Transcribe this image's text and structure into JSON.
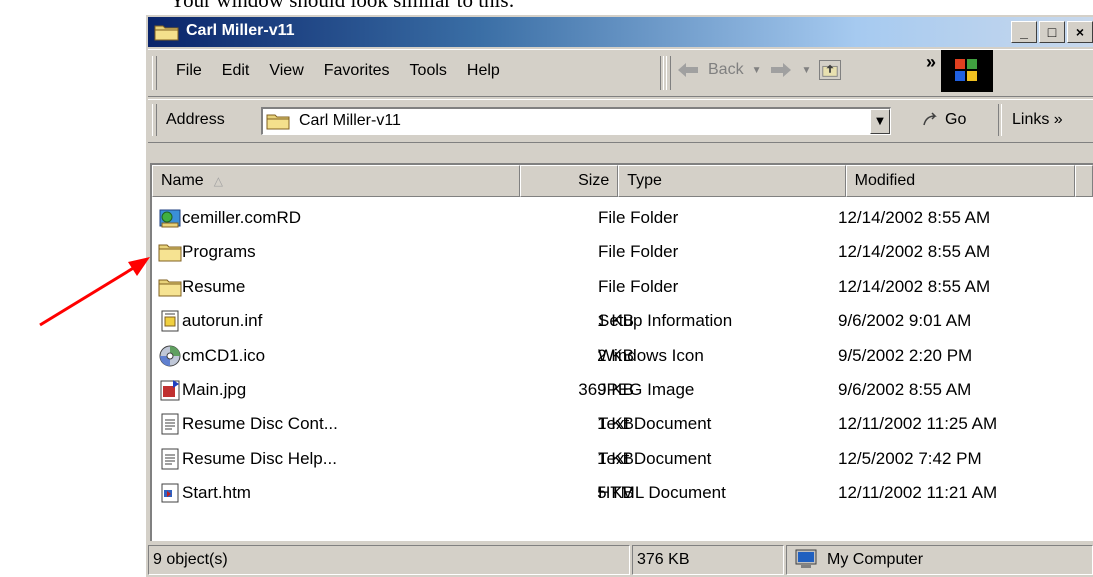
{
  "caption": "Your window should look similar to this:",
  "window": {
    "title": "Carl Miller-v11",
    "buttons": {
      "minimize": "_",
      "maximize": "□",
      "close": "×"
    }
  },
  "menu": {
    "items": [
      "File",
      "Edit",
      "View",
      "Favorites",
      "Tools",
      "Help"
    ],
    "back_label": "Back",
    "chevron": "»"
  },
  "address": {
    "label": "Address",
    "value": "Carl Miller-v11",
    "go_label": "Go",
    "links_label": "Links »"
  },
  "columns": {
    "name": "Name",
    "size": "Size",
    "type": "Type",
    "modified": "Modified"
  },
  "files": [
    {
      "icon": "network-folder-icon",
      "name": "cemiller.comRD",
      "size": "",
      "type": "File Folder",
      "modified": "12/14/2002 8:55 AM"
    },
    {
      "icon": "folder-icon",
      "name": "Programs",
      "size": "",
      "type": "File Folder",
      "modified": "12/14/2002 8:55 AM"
    },
    {
      "icon": "folder-icon",
      "name": "Resume",
      "size": "",
      "type": "File Folder",
      "modified": "12/14/2002 8:55 AM"
    },
    {
      "icon": "setup-info-icon",
      "name": "autorun.inf",
      "size": "1 KB",
      "type": "Setup Information",
      "modified": "9/6/2002 9:01 AM"
    },
    {
      "icon": "cd-icon",
      "name": "cmCD1.ico",
      "size": "2 KB",
      "type": "Windows Icon",
      "modified": "9/5/2002 2:20 PM"
    },
    {
      "icon": "image-icon",
      "name": "Main.jpg",
      "size": "369 KB",
      "type": "JPEG Image",
      "modified": "9/6/2002 8:55 AM"
    },
    {
      "icon": "text-doc-icon",
      "name": "Resume Disc Cont...",
      "size": "1 KB",
      "type": "Text Document",
      "modified": "12/11/2002 11:25 AM"
    },
    {
      "icon": "text-doc-icon",
      "name": "Resume Disc Help...",
      "size": "1 KB",
      "type": "Text Document",
      "modified": "12/5/2002 7:42 PM"
    },
    {
      "icon": "html-doc-icon",
      "name": "Start.htm",
      "size": "5 KB",
      "type": "HTML Document",
      "modified": "12/11/2002 11:21 AM"
    }
  ],
  "status": {
    "objects": "9 object(s)",
    "size": "376 KB",
    "location": "My Computer"
  },
  "colors": {
    "title_start": "#0a246a",
    "title_end": "#a6caf0",
    "chrome": "#d4d0c8",
    "annotation_arrow": "#ff0000"
  }
}
